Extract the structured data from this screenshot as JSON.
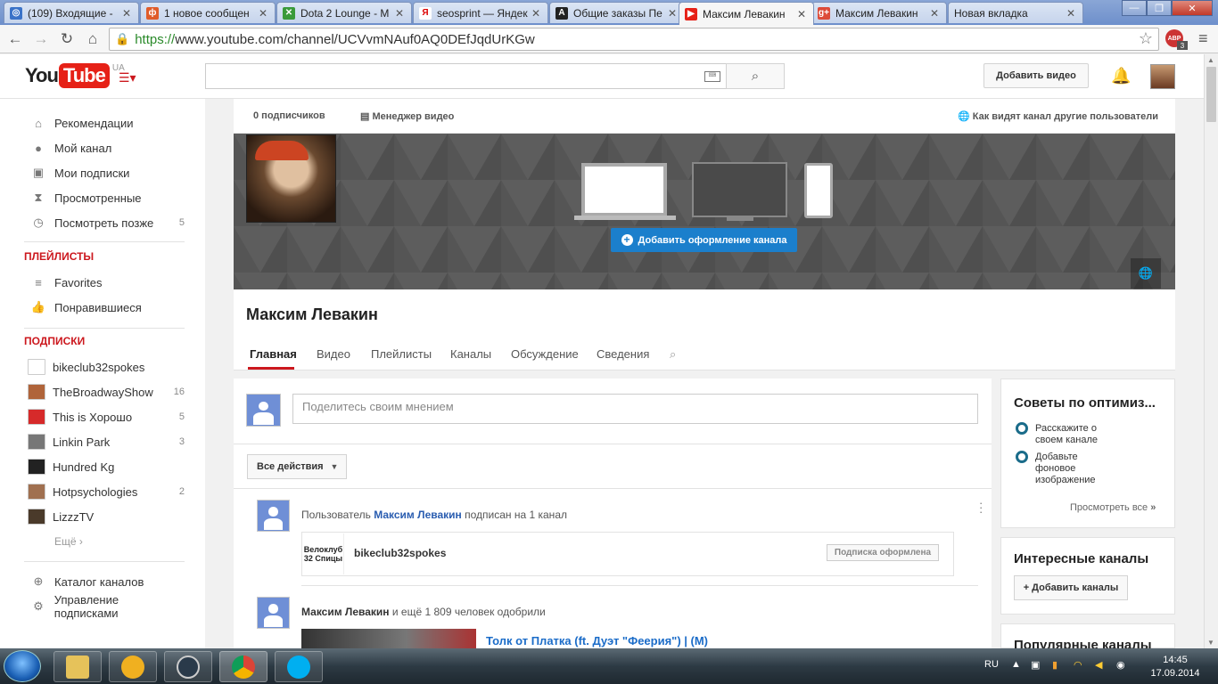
{
  "browser": {
    "tabs": [
      {
        "title": "(109) Входящие - ",
        "color": "#3b73c8",
        "glyph": "◎"
      },
      {
        "title": "1 новое сообщен",
        "color": "#e05c2a",
        "glyph": "ф"
      },
      {
        "title": "Dota 2 Lounge - М",
        "color": "#3a9a3a",
        "glyph": "✕"
      },
      {
        "title": "seosprint — Яндек",
        "color": "#ffffff",
        "glyph": "Я"
      },
      {
        "title": "Общие заказы Пе",
        "color": "#222222",
        "glyph": "A"
      },
      {
        "title": "Максим Левакин",
        "color": "#e62117",
        "glyph": "▶"
      },
      {
        "title": "Максим Левакин",
        "color": "#dd4b39",
        "glyph": "g+"
      },
      {
        "title": "Новая вкладка",
        "color": "",
        "glyph": ""
      }
    ],
    "url_scheme": "https://",
    "url_rest": "www.youtube.com/channel/UCVvmNAuf0AQ0DEfJqdUrKGw",
    "abp_label": "ABP",
    "abp_count": "3"
  },
  "header": {
    "logo_you": "You",
    "logo_tube": "Tube",
    "region": "UA",
    "search_placeholder": "",
    "upload_label": "Добавить видео"
  },
  "sidebar": {
    "main": [
      {
        "label": "Рекомендации",
        "icon": "⌂",
        "count": ""
      },
      {
        "label": "Мой канал",
        "icon": "●",
        "count": ""
      },
      {
        "label": "Мои подписки",
        "icon": "▣",
        "count": ""
      },
      {
        "label": "Просмотренные",
        "icon": "⧗",
        "count": ""
      },
      {
        "label": "Посмотреть позже",
        "icon": "◷",
        "count": "5"
      }
    ],
    "playlists_heading": "ПЛЕЙЛИСТЫ",
    "playlists": [
      {
        "label": "Favorites",
        "icon": "≡"
      },
      {
        "label": "Понравившиеся",
        "icon": "👍"
      }
    ],
    "subs_heading": "ПОДПИСКИ",
    "subscriptions": [
      {
        "label": "bikeclub32spokes",
        "count": "",
        "color": "#ffffff"
      },
      {
        "label": "TheBroadwayShow",
        "count": "16",
        "color": "#b0643a"
      },
      {
        "label": "This is Хорошо",
        "count": "5",
        "color": "#d62a2a"
      },
      {
        "label": "Linkin Park",
        "count": "3",
        "color": "#777777"
      },
      {
        "label": "Hundred Kg",
        "count": "",
        "color": "#222222"
      },
      {
        "label": "Hotpsychologies",
        "count": "2",
        "color": "#a07050"
      },
      {
        "label": "LizzzTV",
        "count": "",
        "color": "#4a3a2a"
      }
    ],
    "more_label": "Ещё ›",
    "footer": [
      {
        "label": "Каталог каналов",
        "icon": "⊕"
      },
      {
        "label": "Управление подписками",
        "icon": "⚙"
      }
    ]
  },
  "channel": {
    "subscribers": "0 подписчиков",
    "video_manager": "Менеджер видео",
    "view_as": "Как видят канал другие пользователи",
    "add_art": "Добавить оформление канала",
    "name": "Максим Левакин",
    "tabs": [
      "Главная",
      "Видео",
      "Плейлисты",
      "Каналы",
      "Обсуждение",
      "Сведения"
    ]
  },
  "feed": {
    "comment_placeholder": "Поделитесь своим мнением",
    "filter_label": "Все действия",
    "activity1": {
      "prefix": "Пользователь",
      "user": "Максим Левакин",
      "suffix": "подписан на 1 канал"
    },
    "sub_card": {
      "logo_text": "Велоклуб 32 Спицы",
      "name": "bikeclub32spokes",
      "button": "Подписка оформлена"
    },
    "activity2": {
      "user": "Максим Левакин",
      "suffix": "и ещё 1 809 человек одобрили"
    },
    "video_title": "Толк от Платка (ft. Дуэт \"Феерия\") | (M)"
  },
  "right": {
    "tips_title": "Советы по оптимиз...",
    "tips": [
      "Расскажите о своем канале",
      "Добавьте фоновое изображение"
    ],
    "view_all": "Просмотреть все",
    "interesting_title": "Интересные каналы",
    "add_channels": "+ Добавить каналы",
    "popular_title": "Популярные каналы"
  },
  "taskbar": {
    "lang": "RU",
    "time": "14:45",
    "date": "17.09.2014"
  }
}
